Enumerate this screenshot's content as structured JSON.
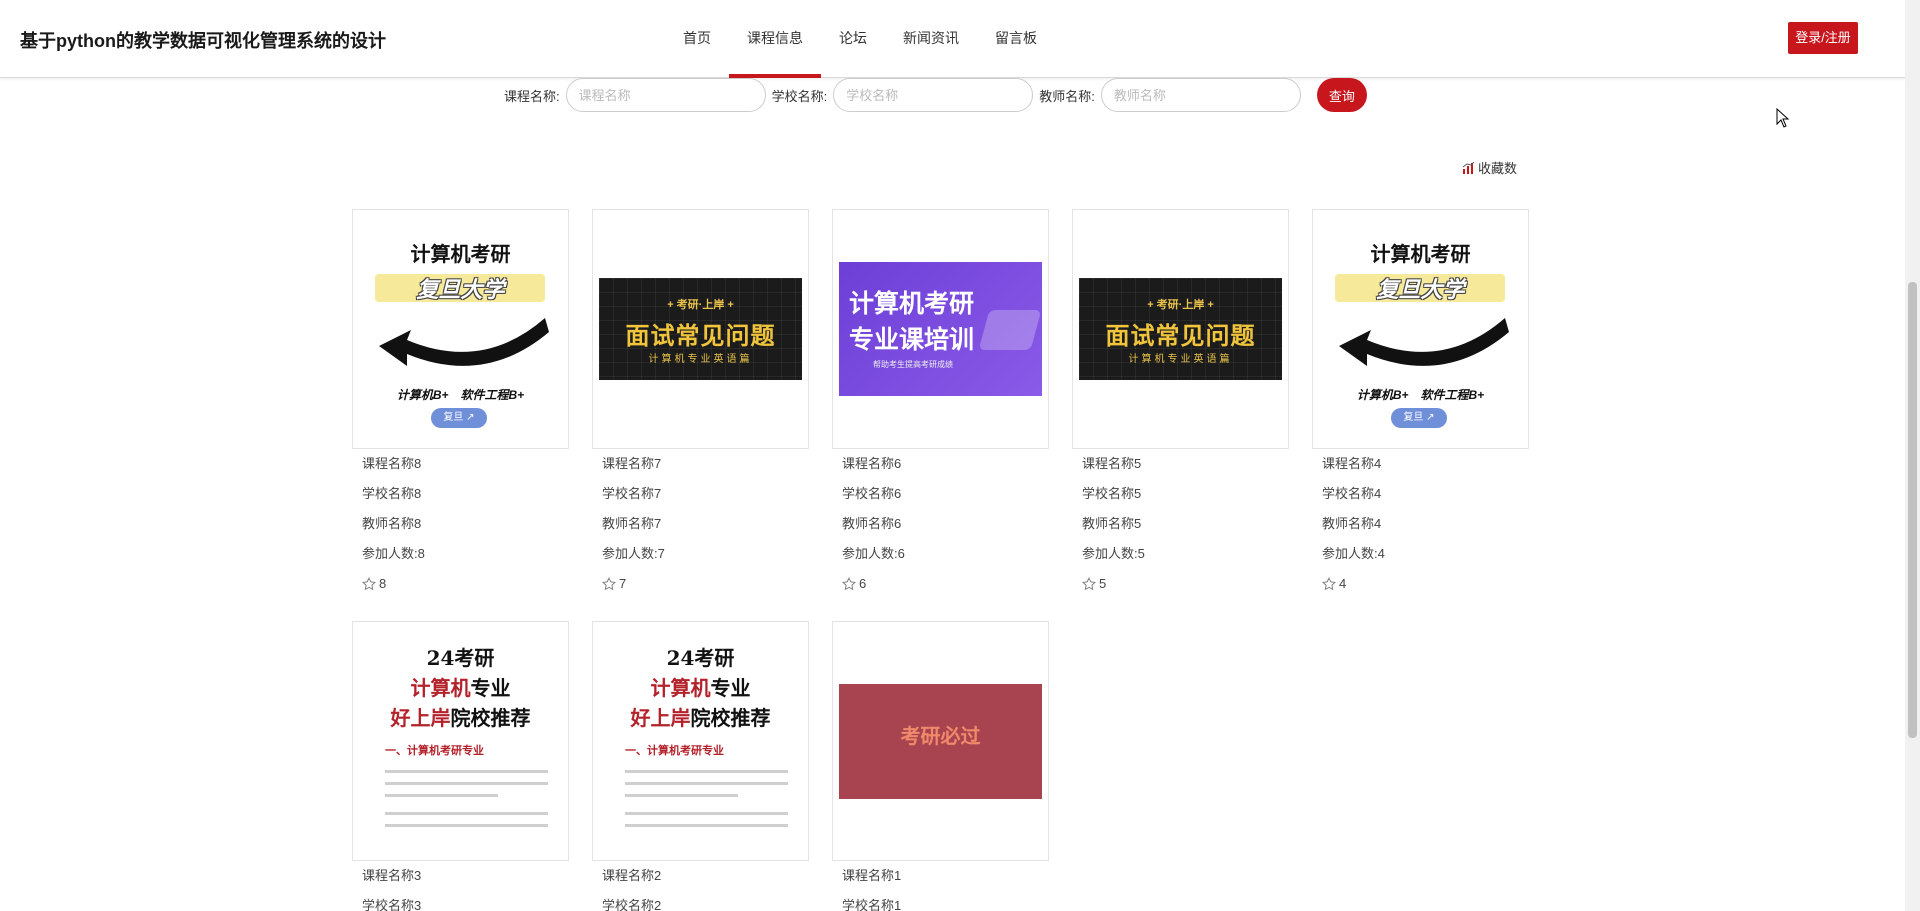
{
  "header": {
    "site_title": "基于python的教学数据可视化管理系统的设计",
    "nav": [
      "首页",
      "课程信息",
      "论坛",
      "新闻资讯",
      "留言板"
    ],
    "active_nav": 1,
    "login_label": "登录/注册"
  },
  "search": {
    "course_label": "课程名称:",
    "course_placeholder": "课程名称",
    "school_label": "学校名称:",
    "school_placeholder": "学校名称",
    "teacher_label": "教师名称:",
    "teacher_placeholder": "教师名称",
    "query_label": "查询"
  },
  "sort_label": "收藏数",
  "theme": {
    "accent": "#c8161d"
  },
  "cards": [
    {
      "art": "fudan",
      "course": "课程名称8",
      "school": "学校名称8",
      "teacher": "教师名称8",
      "participants": "参加人数:8",
      "favorites": "8"
    },
    {
      "art": "dark",
      "course": "课程名称7",
      "school": "学校名称7",
      "teacher": "教师名称7",
      "participants": "参加人数:7",
      "favorites": "7"
    },
    {
      "art": "purple",
      "course": "课程名称6",
      "school": "学校名称6",
      "teacher": "教师名称6",
      "participants": "参加人数:6",
      "favorites": "6"
    },
    {
      "art": "dark",
      "course": "课程名称5",
      "school": "学校名称5",
      "teacher": "教师名称5",
      "participants": "参加人数:5",
      "favorites": "5"
    },
    {
      "art": "fudan",
      "course": "课程名称4",
      "school": "学校名称4",
      "teacher": "教师名称4",
      "participants": "参加人数:4",
      "favorites": "4"
    },
    {
      "art": "paper",
      "course": "课程名称3",
      "school": "学校名称3"
    },
    {
      "art": "paper",
      "course": "课程名称2",
      "school": "学校名称2"
    },
    {
      "art": "red",
      "course": "课程名称1",
      "school": "学校名称1"
    }
  ],
  "art_text": {
    "fudan": {
      "title": "计算机考研",
      "school": "复旦大学",
      "tags": "计算机B+　软件工程B+",
      "pill": "复旦 ↗"
    },
    "dark": {
      "top": "+ 考研·上岸 +",
      "main": "面试常见问题",
      "bottom": "计算机专业英语篇"
    },
    "purple": {
      "line1": "计算机考研",
      "line2": "专业课培训",
      "line3": "帮助考生提高考研成绩"
    },
    "paper": {
      "line1": "24考研",
      "line2_red": "计算机",
      "line2": "专业",
      "line3_red": "好上岸",
      "line3": "院校推荐",
      "section": "一、计算机考研专业"
    },
    "red": {
      "text": "考研必过"
    }
  }
}
